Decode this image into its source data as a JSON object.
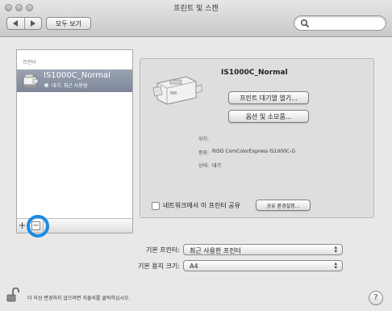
{
  "window": {
    "title": "프린트 및 스캔"
  },
  "toolbar": {
    "show_all_label": "모두 보기",
    "search_placeholder": ""
  },
  "printer_list": {
    "header": "프린터",
    "items": [
      {
        "name": "IS1000C_Normal",
        "status": "대기, 최근 사용됨"
      }
    ],
    "add_label": "+",
    "remove_label": "−"
  },
  "detail": {
    "printer_name": "IS1000C_Normal",
    "open_queue_label": "프린트 대기열 열기...",
    "options_label": "옵션 및 소모품...",
    "info": [
      {
        "label": "위치:",
        "value": ""
      },
      {
        "label": "종류:",
        "value": "RISO ComColorExpress IS1000C-G"
      },
      {
        "label": "상태:",
        "value": "대기"
      }
    ],
    "share_label": "네트워크에서 이 프린터 공유",
    "share_settings_label": "공유 환경설정..."
  },
  "defaults": {
    "printer_label": "기본 프린터:",
    "printer_value": "최근 사용한 프린터",
    "paper_label": "기본 용지 크기:",
    "paper_value": "A4"
  },
  "footer": {
    "lock_text": "더 이상 변경하지 않으려면 자물쇠를 클릭하십시오.",
    "help_label": "?"
  },
  "colors": {
    "selection": "#8a94a6",
    "highlight_ring": "#1a8be2"
  }
}
